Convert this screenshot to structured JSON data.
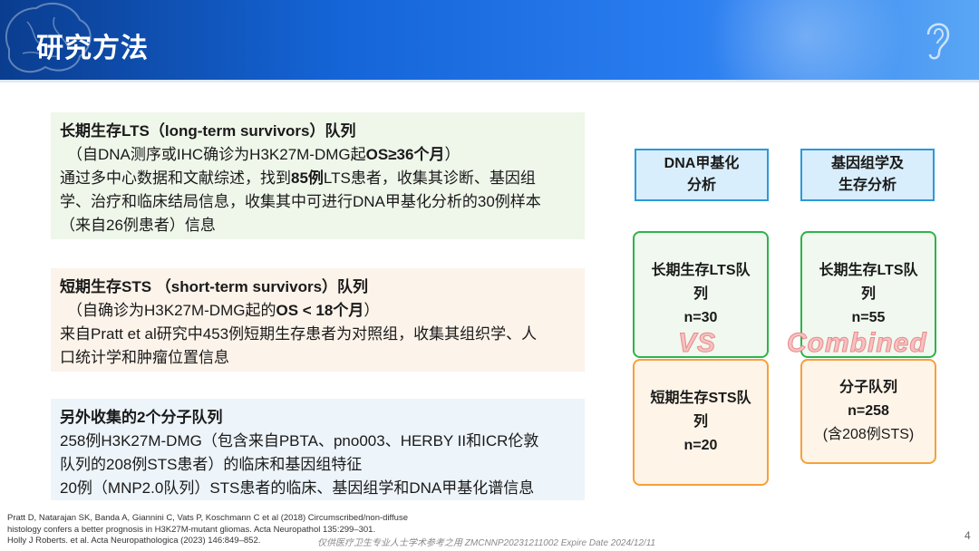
{
  "header": {
    "title": "研究方法"
  },
  "blocks": {
    "lts": {
      "heading": "长期生存LTS（long-term survivors）队列",
      "criteria_pre": "（自DNA测序或IHC确诊为H3K27M-DMG起",
      "criteria_bold": "OS≥36个月",
      "criteria_post": "）",
      "desc_pre": "通过多中心数据和文献综述，找到",
      "desc_bold": "85例",
      "desc_line1_post": "LTS患者，收集其诊断、基因组",
      "desc_line2": "学、治疗和临床结局信息，收集其中可进行DNA甲基化分析的30例样本",
      "desc_line3": "（来自26例患者）信息"
    },
    "sts": {
      "heading": "短期生存STS （short-term survivors）队列",
      "criteria_pre": "（自确诊为H3K27M-DMG起的",
      "criteria_bold": "OS < 18个月",
      "criteria_post": "）",
      "desc_line1": "来自Pratt et al研究中453例短期生存患者为对照组，收集其组织学、人",
      "desc_line2": "口统计学和肿瘤位置信息"
    },
    "extra": {
      "heading": "另外收集的2个分子队列",
      "line1": "258例H3K27M-DMG（包含来自PBTA、pno003、HERBY II和ICR伦敦",
      "line2": "队列的208例STS患者）的临床和基因组特征",
      "line3": "20例（MNP2.0队列）STS患者的临床、基因组学和DNA甲基化谱信息"
    }
  },
  "diagram": {
    "col1_header_l1": "DNA甲基化",
    "col1_header_l2": "分析",
    "col2_header_l1": "基因组学及",
    "col2_header_l2": "生存分析",
    "col1_lts_l1": "长期生存LTS队",
    "col1_lts_l2": "列",
    "col1_lts_n": "n=30",
    "col2_lts_l1": "长期生存LTS队",
    "col2_lts_l2": "列",
    "col2_lts_n": "n=55",
    "vs_label": "VS",
    "combined_label": "Combined",
    "col1_sts_l1": "短期生存STS队",
    "col1_sts_l2": "列",
    "col1_sts_n": "n=20",
    "col2_mol_l1": "分子队列",
    "col2_mol_n": "n=258",
    "col2_mol_note": "(含208例STS)"
  },
  "footer": {
    "ref1_l1": "Pratt D, Natarajan SK, Banda A, Giannini C, Vats P, Koschmann C et al (2018) Circumscribed/non-diffuse",
    "ref1_l2": "histology confers a better prognosis in H3K27M-mutant gliomas. Acta Neuropathol 135:299–301.",
    "ref2": "Holly J Roberts. et al. Acta Neuropathologica (2023) 146:849–852.",
    "watermark": "仅供医疗卫生专业人士学术参考之用 ZMCNNP20231211002 Expire Date 2024/12/11",
    "page": "4"
  },
  "colors": {
    "header_blue": "#1565d8",
    "green_border": "#2fb24a",
    "orange_border": "#f5a13a",
    "blue_border": "#2b9ad8"
  }
}
